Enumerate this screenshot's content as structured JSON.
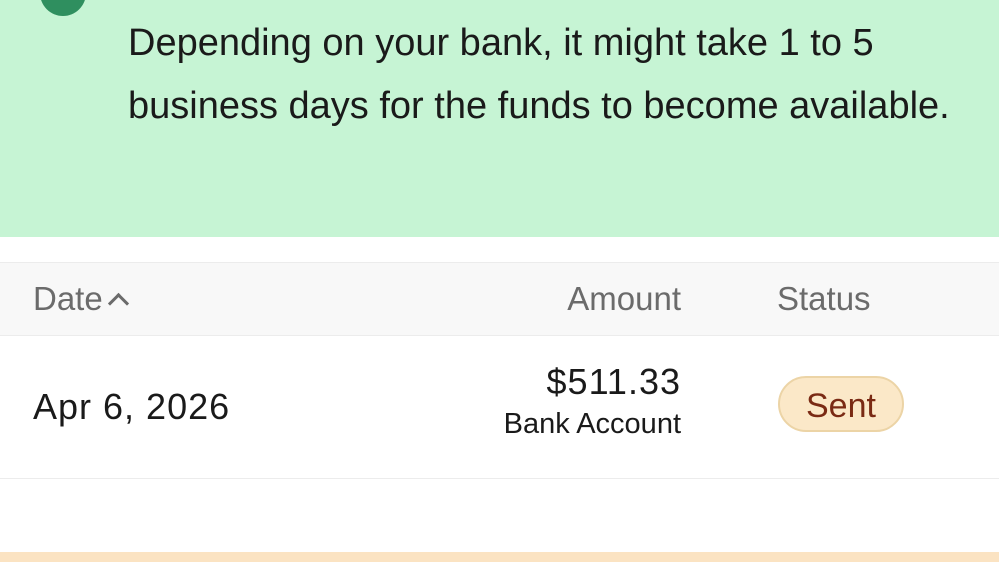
{
  "banner": {
    "message": "Depending on your bank, it might take 1 to 5 business days for the funds to become available.",
    "background_color": "#c6f4d4",
    "icon": "status-circle-icon"
  },
  "table": {
    "columns": {
      "date": "Date",
      "amount": "Amount",
      "status": "Status"
    },
    "sort": {
      "column": "date",
      "direction": "ascending",
      "icon": "chevron-up-icon"
    },
    "rows": [
      {
        "date": "Apr 6, 2026",
        "amount": "$511.33",
        "method": "Bank Account",
        "status": "Sent",
        "status_color": "#fbe8c8"
      }
    ]
  }
}
